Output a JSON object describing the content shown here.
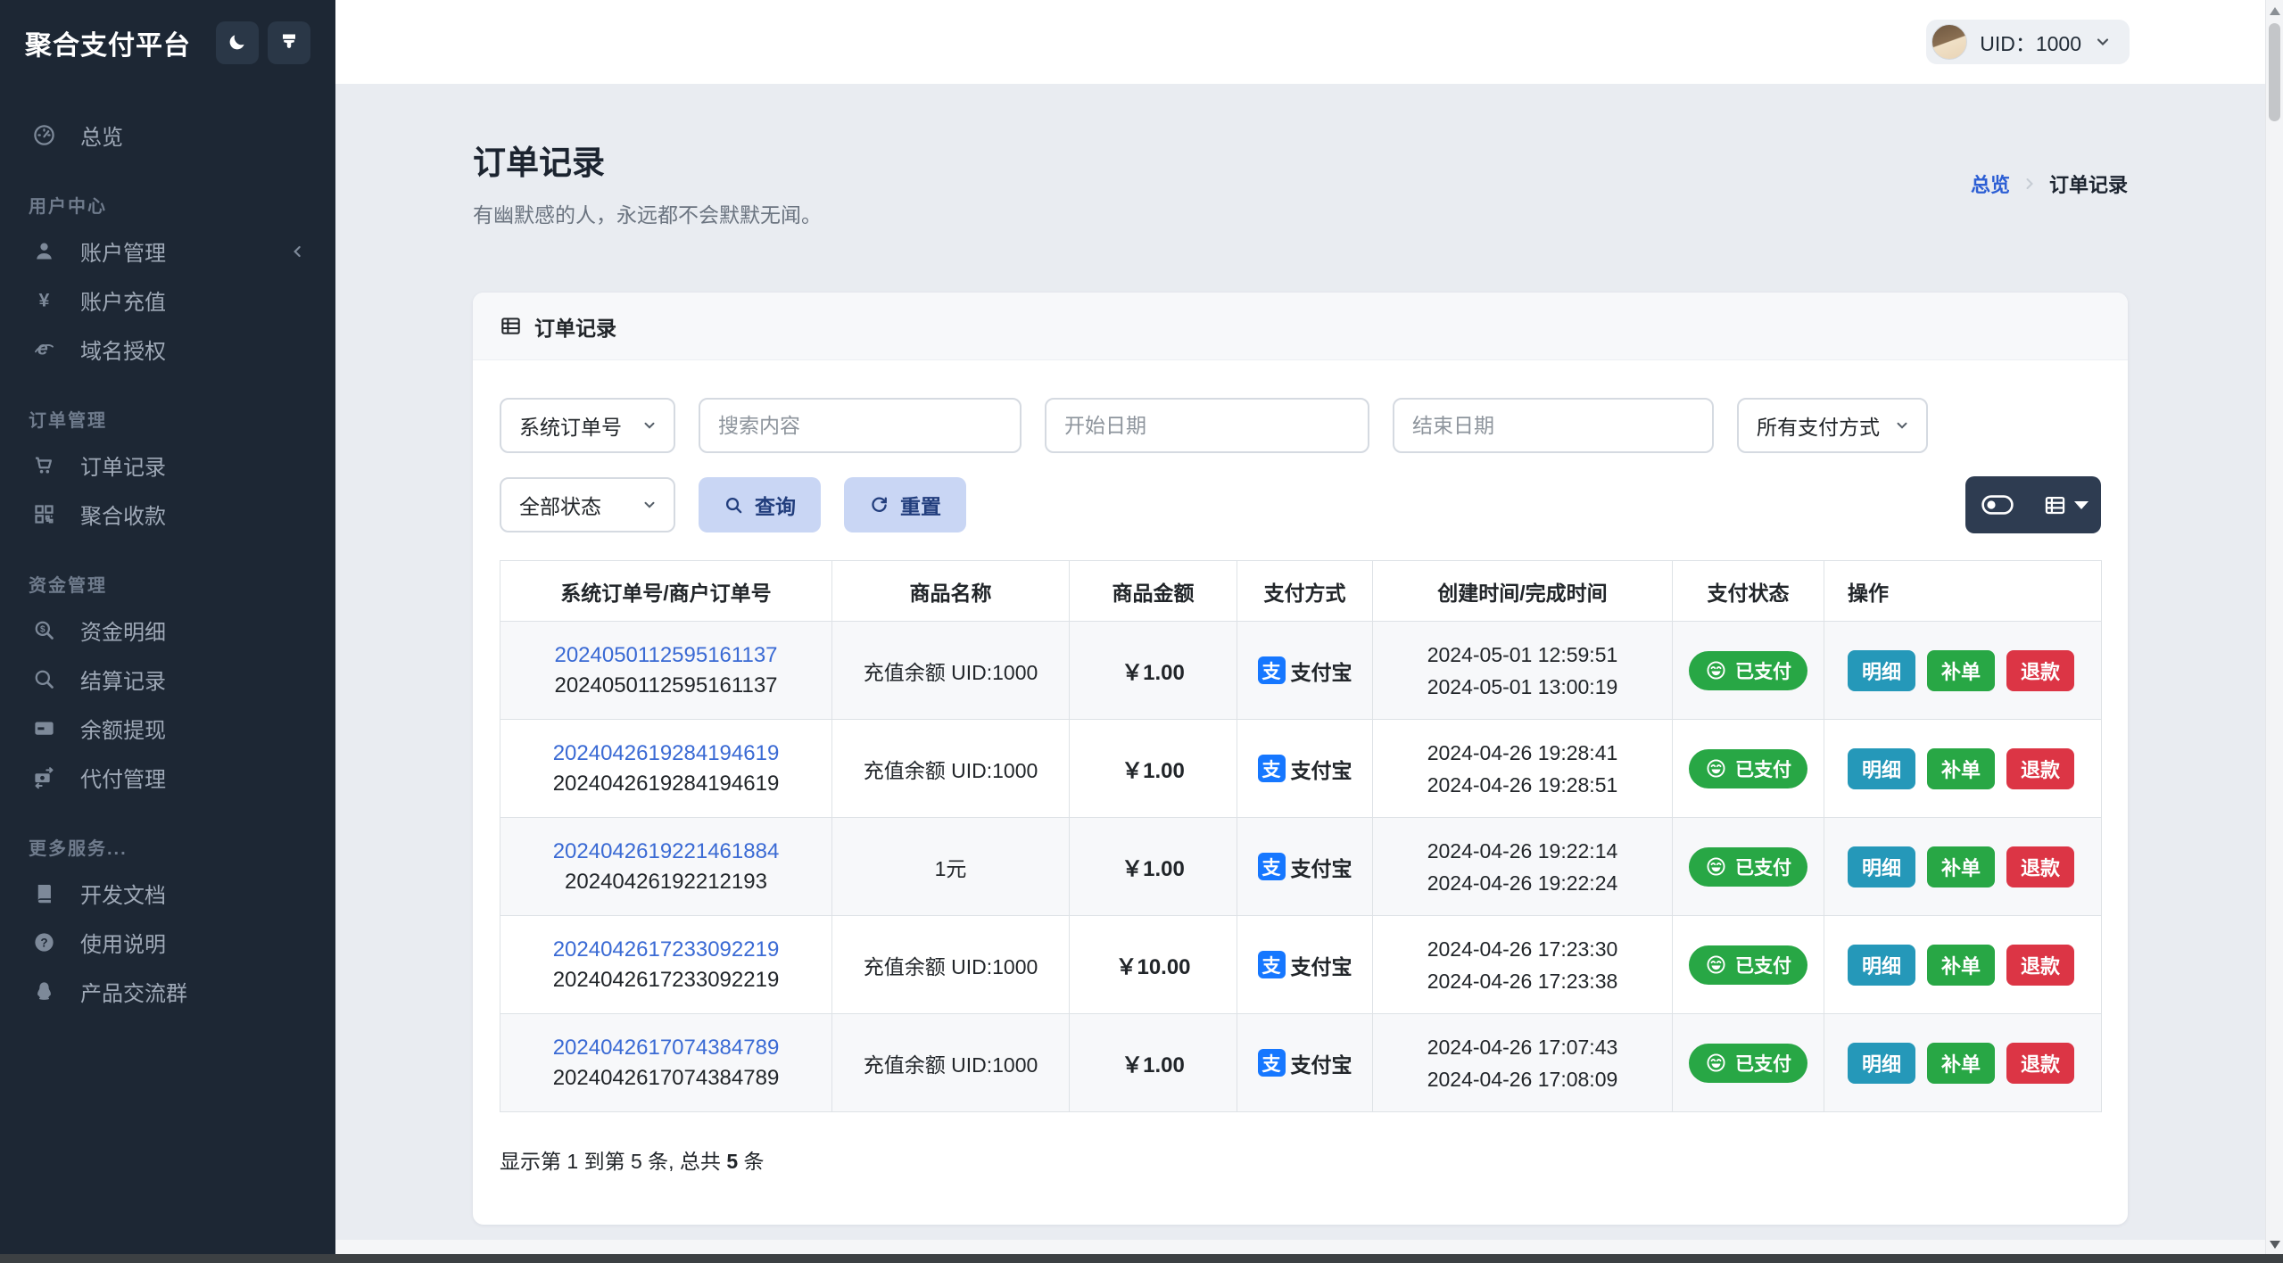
{
  "brand": {
    "title": "聚合支付平台"
  },
  "topbar": {
    "uid": "UID：1000"
  },
  "sidebar": {
    "overview": {
      "label": "总览",
      "icon": "gauge-icon"
    },
    "groups": [
      {
        "heading": "用户中心",
        "items": [
          {
            "label": "账户管理",
            "icon": "user-icon",
            "collapsible": true
          },
          {
            "label": "账户充值",
            "icon": "yen-icon"
          },
          {
            "label": "域名授权",
            "icon": "browser-icon"
          }
        ]
      },
      {
        "heading": "订单管理",
        "items": [
          {
            "label": "订单记录",
            "icon": "cart-icon"
          },
          {
            "label": "聚合收款",
            "icon": "qrcode-icon"
          }
        ]
      },
      {
        "heading": "资金管理",
        "items": [
          {
            "label": "资金明细",
            "icon": "search-dollar-icon"
          },
          {
            "label": "结算记录",
            "icon": "search-icon"
          },
          {
            "label": "余额提现",
            "icon": "credit-card-icon"
          },
          {
            "label": "代付管理",
            "icon": "money-transfer-icon"
          }
        ]
      },
      {
        "heading": "更多服务...",
        "items": [
          {
            "label": "开发文档",
            "icon": "book-icon"
          },
          {
            "label": "使用说明",
            "icon": "question-icon"
          },
          {
            "label": "产品交流群",
            "icon": "qq-icon"
          }
        ]
      }
    ]
  },
  "page": {
    "title": "订单记录",
    "subtitle": "有幽默感的人，永远都不会默默无闻。",
    "breadcrumb_root": "总览",
    "breadcrumb_current": "订单记录"
  },
  "card": {
    "title": "订单记录"
  },
  "filters": {
    "order_no_type": "系统订单号",
    "search_placeholder": "搜索内容",
    "start_date_placeholder": "开始日期",
    "end_date_placeholder": "结束日期",
    "pay_method": "所有支付方式",
    "status": "全部状态",
    "query": "查询",
    "reset": "重置"
  },
  "table": {
    "headers": [
      "系统订单号/商户订单号",
      "商品名称",
      "商品金额",
      "支付方式",
      "创建时间/完成时间",
      "支付状态",
      "操作"
    ],
    "pay_icon_char": "支",
    "pay_method_label": "支付宝",
    "status_label": "已支付",
    "actions": [
      "明细",
      "补单",
      "退款"
    ],
    "rows": [
      {
        "sys_no": "2024050112595161137",
        "merchant_no": "2024050112595161137",
        "product": "充值余额 UID:1000",
        "amount": "￥1.00",
        "created": "2024-05-01 12:59:51",
        "completed": "2024-05-01 13:00:19"
      },
      {
        "sys_no": "2024042619284194619",
        "merchant_no": "2024042619284194619",
        "product": "充值余额 UID:1000",
        "amount": "￥1.00",
        "created": "2024-04-26 19:28:41",
        "completed": "2024-04-26 19:28:51"
      },
      {
        "sys_no": "2024042619221461884",
        "merchant_no": "20240426192212193",
        "product": "1元",
        "amount": "￥1.00",
        "created": "2024-04-26 19:22:14",
        "completed": "2024-04-26 19:22:24"
      },
      {
        "sys_no": "2024042617233092219",
        "merchant_no": "2024042617233092219",
        "product": "充值余额 UID:1000",
        "amount": "￥10.00",
        "created": "2024-04-26 17:23:30",
        "completed": "2024-04-26 17:23:38"
      },
      {
        "sys_no": "2024042617074384789",
        "merchant_no": "2024042617074384789",
        "product": "充值余额 UID:1000",
        "amount": "￥1.00",
        "created": "2024-04-26 17:07:43",
        "completed": "2024-04-26 17:08:09"
      }
    ]
  },
  "pagination": {
    "prefix": "显示第 1 到第 5 条, 总共 ",
    "total": "5",
    "suffix": " 条"
  },
  "colors": {
    "sidebar_bg": "#1d2734",
    "accent_blue": "#2c5ed4",
    "link_blue": "#3a6ad4",
    "success_green": "#28a745",
    "info_teal": "#2598b9",
    "danger_red": "#dc3545",
    "alipay_blue": "#1677ff",
    "soft_button_bg": "#c9d6f4",
    "dark_control_bg": "#2e3c51"
  }
}
